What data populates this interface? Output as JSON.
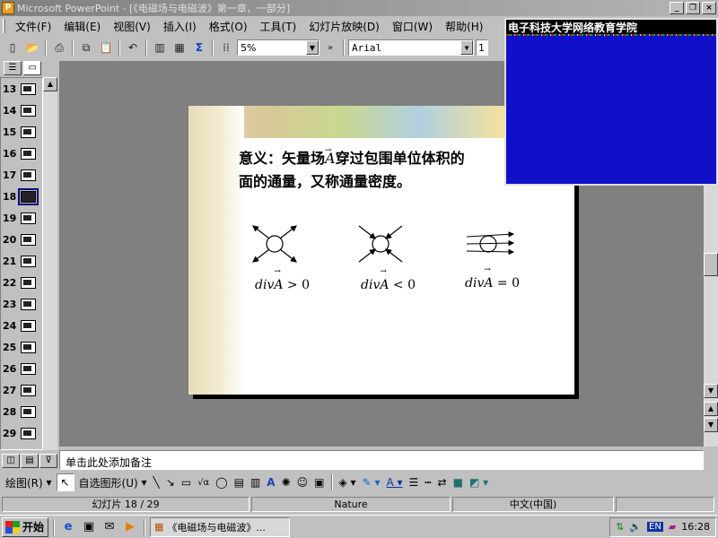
{
  "window": {
    "title": "Microsoft PowerPoint - [《电磁场与电磁波》第一章，一部分]",
    "app_icon": "powerpoint-icon"
  },
  "menu": [
    "文件(F)",
    "编辑(E)",
    "视图(V)",
    "插入(I)",
    "格式(O)",
    "工具(T)",
    "幻灯片放映(D)",
    "窗口(W)",
    "帮助(H)"
  ],
  "toolbar": {
    "zoom": "5%",
    "font": "Arial",
    "font_size": "1"
  },
  "popup": {
    "title": "电子科技大学网络教育学院"
  },
  "thumbnails": {
    "numbers": [
      "13",
      "14",
      "15",
      "16",
      "17",
      "18",
      "19",
      "20",
      "21",
      "22",
      "23",
      "24",
      "25",
      "26",
      "27",
      "28",
      "29"
    ],
    "selected": "18"
  },
  "slide": {
    "line1_prefix": "意义：矢量场",
    "line1_vec": "A",
    "line1_suffix": "穿过包围单位体积的",
    "line2": "面的通量，又称通量密度。",
    "formulas": [
      {
        "div": "div",
        "vec": "A",
        "rel": " > 0"
      },
      {
        "div": "div",
        "vec": "A",
        "rel": " < 0"
      },
      {
        "div": "div",
        "vec": "A",
        "rel": " = 0"
      }
    ]
  },
  "notes": {
    "placeholder": "单击此处添加备注"
  },
  "drawbar": {
    "draw_label": "绘图(R)",
    "autoshape_label": "自选图形(U)"
  },
  "status": {
    "slide": "幻灯片 18 / 29",
    "design": "Nature",
    "language": "中文(中国)"
  },
  "taskbar": {
    "start": "开始",
    "task": "《电磁场与电磁波》...",
    "tray_lang": "EN",
    "clock": "16:28"
  }
}
